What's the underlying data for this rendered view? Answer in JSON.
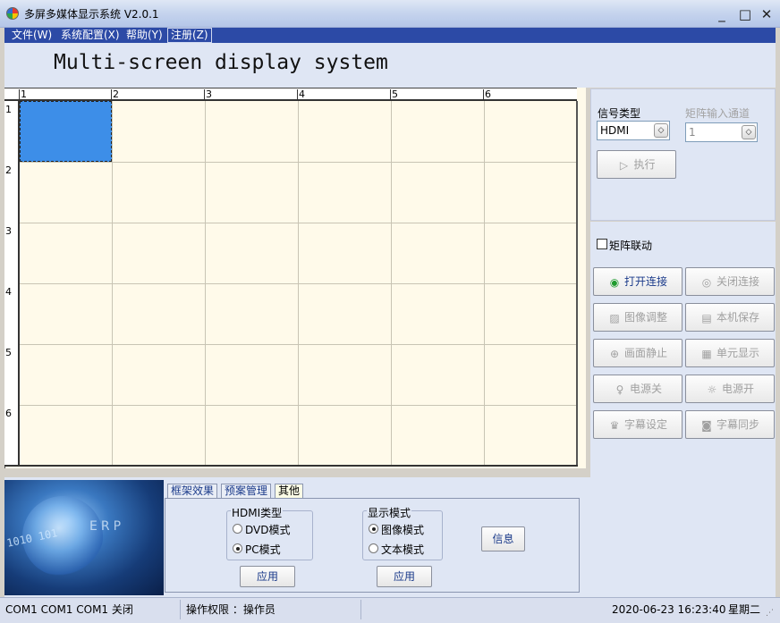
{
  "window": {
    "title": "多屏多媒体显示系统 V2.0.1",
    "controls": {
      "minimize": "_",
      "maximize": "□",
      "close": "✕"
    }
  },
  "menu": {
    "items": [
      "文件(W)",
      "系统配置(X)",
      "帮助(Y)",
      "注册(Z)"
    ]
  },
  "header": {
    "title": "Multi-screen display system"
  },
  "grid": {
    "columns": [
      "1",
      "2",
      "3",
      "4",
      "5",
      "6"
    ],
    "rows": [
      "1",
      "2",
      "3",
      "4",
      "5",
      "6"
    ],
    "selected_cell": {
      "row": 1,
      "col": 1
    },
    "selected_color": "#3d8ee8"
  },
  "signal_panel": {
    "signal_type_label": "信号类型",
    "signal_type_value": "HDMI",
    "matrix_channel_label": "矩阵输入通道",
    "matrix_channel_value": "1",
    "execute_button": "执行",
    "matrix_link_label": "矩阵联动"
  },
  "actions": {
    "open_connection": "打开连接",
    "close_connection": "关闭连接",
    "image_adjust": "图像调整",
    "local_save": "本机保存",
    "freeze_screen": "画面静止",
    "unit_display": "单元显示",
    "power_off": "电源关",
    "power_on": "电源开",
    "subtitle_settings": "字幕设定",
    "subtitle_sync": "字幕同步"
  },
  "bottom": {
    "banner_digits": "1010 101",
    "banner_text": "ERP",
    "tabs": [
      "框架效果",
      "预案管理",
      "其他"
    ],
    "active_tab": 2,
    "hdmi_group": {
      "title": "HDMI类型",
      "options": [
        "DVD模式",
        "PC模式"
      ],
      "selected": 1,
      "apply": "应用"
    },
    "display_group": {
      "title": "显示模式",
      "options": [
        "图像模式",
        "文本模式"
      ],
      "selected": 0,
      "apply": "应用"
    },
    "info_button": "信息"
  },
  "status": {
    "ports": "COM1 COM1 COM1 关闭",
    "permission": "操作权限 ：操作员",
    "datetime": "2020-06-23 16:23:40",
    "weekday": "星期二"
  },
  "colors": {
    "accent": "#2c4aa6",
    "grid_bg": "#fffaea",
    "panel_bg": "#dfe6f4"
  }
}
